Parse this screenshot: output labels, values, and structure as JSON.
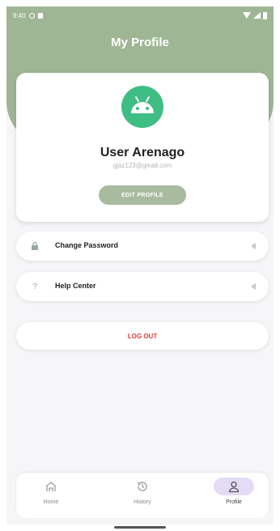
{
  "status_bar": {
    "time": "9:40"
  },
  "header": {
    "title": "My Profile"
  },
  "profile": {
    "avatar_icon": "android-icon",
    "name": "User Arenago",
    "email": "gjaz123@gmail.com",
    "edit_button": "EDIT PROFILE"
  },
  "menu": {
    "items": [
      {
        "icon": "lock-icon",
        "label": "Change Password"
      },
      {
        "icon": "help-icon",
        "label": "Help Center"
      }
    ]
  },
  "logout": {
    "label": "LOG OUT"
  },
  "bottom_nav": {
    "items": [
      {
        "icon": "home-icon",
        "label": "Home",
        "active": false
      },
      {
        "icon": "history-icon",
        "label": "History",
        "active": false
      },
      {
        "icon": "profile-icon",
        "label": "Profile",
        "active": true
      }
    ]
  },
  "colors": {
    "header_green": "#9fb695",
    "avatar_green": "#3ebd84",
    "edit_button": "#a9bb9f",
    "logout_red": "#e53935",
    "active_nav_pill": "#e4dcf6"
  }
}
